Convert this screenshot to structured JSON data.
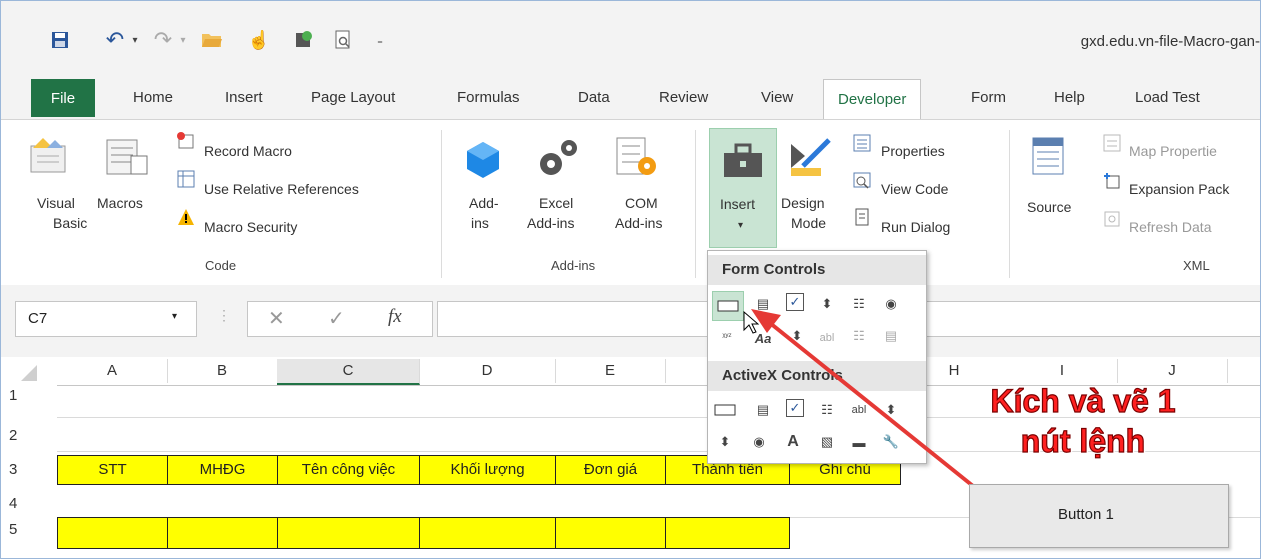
{
  "window": {
    "title": "gxd.edu.vn-file-Macro-gan-"
  },
  "tabs": [
    {
      "label": "File"
    },
    {
      "label": "Home"
    },
    {
      "label": "Insert"
    },
    {
      "label": "Page Layout"
    },
    {
      "label": "Formulas"
    },
    {
      "label": "Data"
    },
    {
      "label": "Review"
    },
    {
      "label": "View"
    },
    {
      "label": "Developer"
    },
    {
      "label": "Form"
    },
    {
      "label": "Help"
    },
    {
      "label": "Load Test"
    }
  ],
  "ribbon": {
    "code": {
      "visual_basic": "Visual\nBasic",
      "visual_basic_l1": "Visual",
      "visual_basic_l2": "Basic",
      "macros": "Macros",
      "record_macro": "Record Macro",
      "use_relative": "Use Relative References",
      "macro_security": "Macro Security",
      "group": "Code"
    },
    "addins": {
      "addins_l1": "Add-",
      "addins_l2": "ins",
      "excel_l1": "Excel",
      "excel_l2": "Add-ins",
      "com_l1": "COM",
      "com_l2": "Add-ins",
      "group": "Add-ins"
    },
    "controls": {
      "insert": "Insert",
      "design_l1": "Design",
      "design_l2": "Mode",
      "properties": "Properties",
      "view_code": "View Code",
      "run_dialog": "Run Dialog"
    },
    "xml": {
      "source": "Source",
      "map_properties": "Map Propertie",
      "expansion_pack": "Expansion Pack",
      "refresh_data": "Refresh Data",
      "group": "XML"
    }
  },
  "formula_bar": {
    "name_box": "C7",
    "fx": "fx"
  },
  "dropdown": {
    "form_controls": "Form Controls",
    "activex_controls": "ActiveX Controls"
  },
  "grid": {
    "columns": [
      "A",
      "B",
      "C",
      "D",
      "E",
      "H",
      "I",
      "J"
    ],
    "rows": [
      "1",
      "2",
      "3",
      "4",
      "5"
    ],
    "header_row": [
      "STT",
      "MHĐG",
      "Tên công việc",
      "Khối lượng",
      "Đơn giá",
      "Thành tiền",
      "Ghi chú"
    ]
  },
  "annotation": {
    "line1": "Kích và vẽ 1",
    "line2": "nút lệnh"
  },
  "button1": {
    "label": "Button 1"
  },
  "colors": {
    "excel_green": "#217346",
    "highlight_yellow": "#ffff00",
    "callout_red": "#ff2020"
  }
}
